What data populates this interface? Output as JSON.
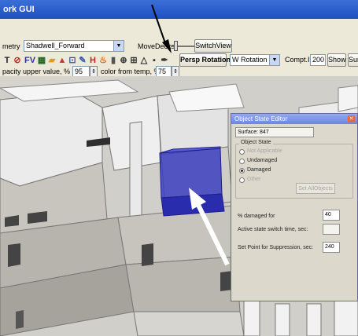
{
  "window": {
    "title": "ork GUI"
  },
  "toolbar1": {
    "geometry_label": "metry",
    "geometry_value": "Shadwell_Forward",
    "movedecks_label": "MoveDecks",
    "switchview_label": "SwitchView"
  },
  "toolbar2": {
    "icons": [
      {
        "name": "text-tool-icon",
        "glyph": "T",
        "color": "#222222"
      },
      {
        "name": "no-entry-icon",
        "glyph": "⊘",
        "color": "#cc2222"
      },
      {
        "name": "fv-icon",
        "glyph": "FV",
        "color": "#333399"
      },
      {
        "name": "film-icon",
        "glyph": "▦",
        "color": "#226622"
      },
      {
        "name": "folder-icon",
        "glyph": "▰",
        "color": "#d8a21c"
      },
      {
        "name": "up-arrow-icon",
        "glyph": "▲",
        "color": "#cc3333"
      },
      {
        "name": "grid-icon",
        "glyph": "⊡",
        "color": "#3355aa"
      },
      {
        "name": "pencil-icon",
        "glyph": "✎",
        "color": "#3355aa"
      },
      {
        "name": "h-icon",
        "glyph": "H",
        "color": "#cc2222"
      },
      {
        "name": "flame-icon",
        "glyph": "♨",
        "color": "#dd6611"
      },
      {
        "name": "bottle-icon",
        "glyph": "▮",
        "color": "#555555"
      },
      {
        "name": "globe-icon",
        "glyph": "⊕",
        "color": "#333333"
      },
      {
        "name": "crosshair-icon",
        "glyph": "⊞",
        "color": "#333333"
      },
      {
        "name": "triangle-icon",
        "glyph": "△",
        "color": "#333333"
      },
      {
        "name": "cursor-icon",
        "glyph": "▪",
        "color": "#333333"
      },
      {
        "name": "wrench-icon",
        "glyph": "✒",
        "color": "#333333"
      }
    ],
    "persp_rotation_label": "Persp Rotation",
    "rotation_value": "W Rotation",
    "compt_id_label": "Compt.ID",
    "compt_id_value": "200",
    "show_label": "Show",
    "surf_label": "Surf"
  },
  "toolbar3": {
    "opacity_label": "pacity upper value, %",
    "opacity_value": "95",
    "color_temp_label": "color from temp, %",
    "color_temp_value": "75"
  },
  "dialog": {
    "title": "Object State Editor",
    "surface_text": "Surface: 847",
    "group_label": "Object State",
    "radio_options": [
      {
        "label": "Not Applicable",
        "selected": false,
        "disabled": true
      },
      {
        "label": "Undamaged",
        "selected": false,
        "disabled": false
      },
      {
        "label": "Damaged",
        "selected": true,
        "disabled": false
      },
      {
        "label": "Other",
        "selected": false,
        "disabled": true
      }
    ],
    "set_all_button": "Set AllObjects",
    "damaged_label": "% damaged for",
    "damaged_value": "40",
    "switch_time_label": "Active state switch time, sec:",
    "switch_time_value": "",
    "suppression_label": "Set Point for Suppression, sec:",
    "suppression_value": "240"
  }
}
